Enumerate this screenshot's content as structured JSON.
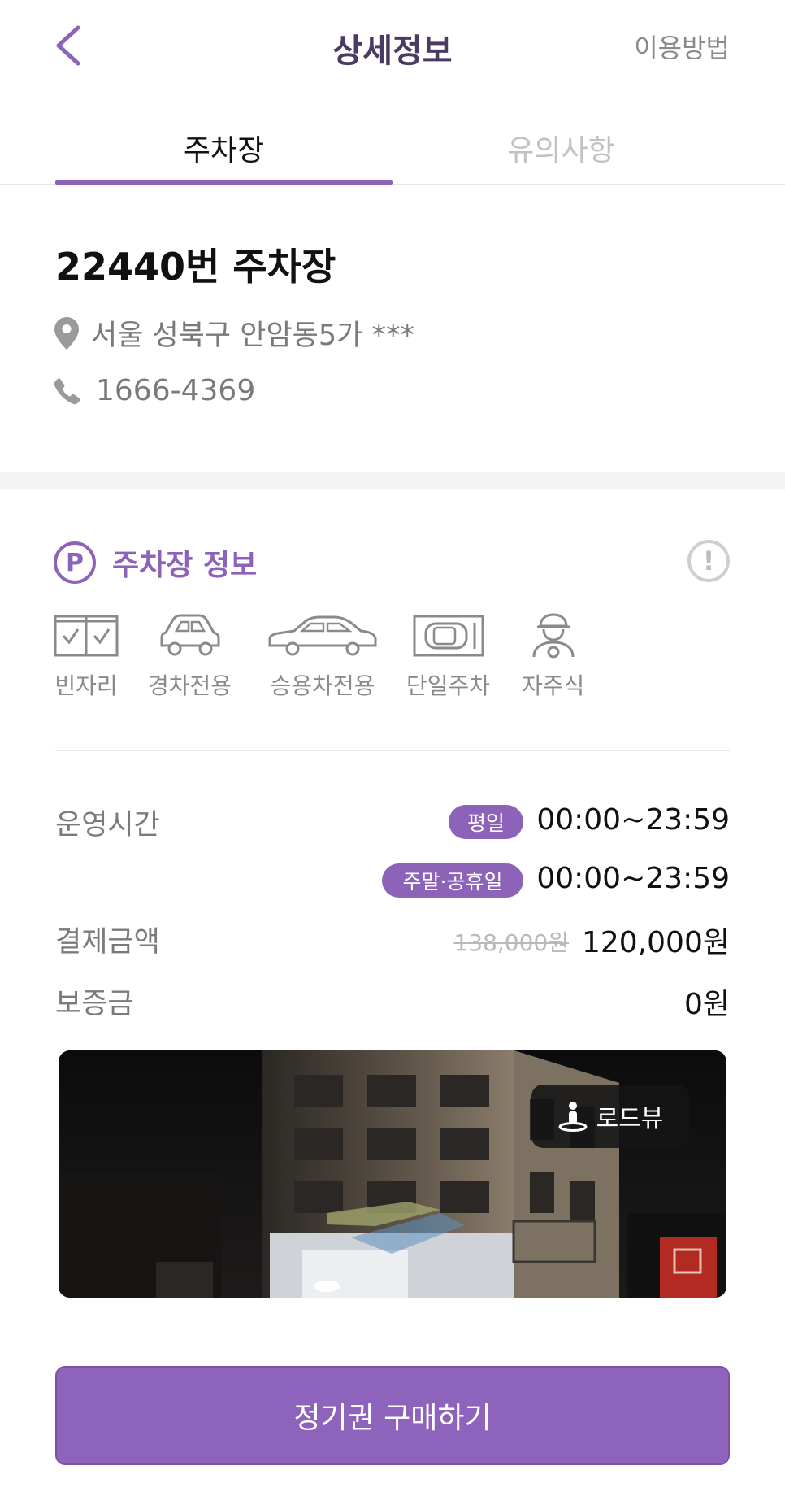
{
  "header": {
    "title": "상세정보",
    "help_label": "이용방법"
  },
  "tabs": [
    {
      "label": "주차장",
      "active": true
    },
    {
      "label": "유의사항",
      "active": false
    }
  ],
  "lot": {
    "name": "22440번 주차장",
    "address": "서울 성북구 안암동5가 ***",
    "phone": "1666-4369"
  },
  "info": {
    "title": "주차장 정보",
    "p_icon": "P",
    "alert_icon": "!",
    "features": [
      {
        "label": "빈자리",
        "icon": "checklist-icon"
      },
      {
        "label": "경차전용",
        "icon": "compact-car-icon"
      },
      {
        "label": "승용차전용",
        "icon": "sedan-icon"
      },
      {
        "label": "단일주차",
        "icon": "single-parking-icon"
      },
      {
        "label": "자주식",
        "icon": "driver-icon"
      }
    ]
  },
  "hours": {
    "label": "운영시간",
    "weekday_badge": "평일",
    "weekday_time": "00:00~23:59",
    "weekend_badge": "주말·공휴일",
    "weekend_time": "00:00~23:59"
  },
  "payment": {
    "label": "결제금액",
    "original": "138,000원",
    "price": "120,000원"
  },
  "deposit": {
    "label": "보증금",
    "value": "0원"
  },
  "photo": {
    "roadview_label": "로드뷰"
  },
  "cta": {
    "label": "정기권 구매하기"
  },
  "colors": {
    "accent": "#8c63b8",
    "muted_text": "#7a7a7a",
    "inactive_tab": "#c2c2c2"
  }
}
